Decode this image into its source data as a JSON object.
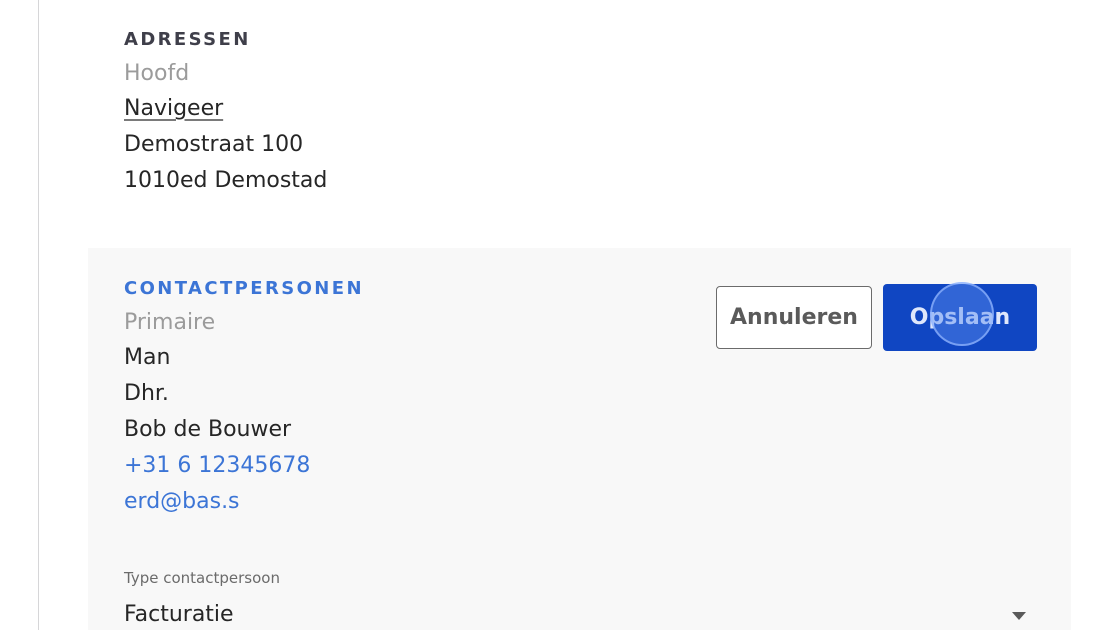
{
  "addresses": {
    "heading": "ADRESSEN",
    "type": "Hoofd",
    "navigate_link": "Navigeer",
    "street": "Demostraat 100",
    "postal_city": "1010ed Demostad"
  },
  "contacts": {
    "heading": "CONTACTPERSONEN",
    "type": "Primaire",
    "gender": "Man",
    "salutation": "Dhr.",
    "name": "Bob de Bouwer",
    "phone": "+31 6 12345678",
    "email": "erd@bas.s",
    "contact_type_label": "Type contactpersoon",
    "contact_type_value": "Facturatie"
  },
  "actions": {
    "cancel_label": "Annuleren",
    "save_label": "Opslaan"
  },
  "colors": {
    "accent_blue": "#3c75d6",
    "primary_button": "#1046c2",
    "heading_dark": "#3f3f4a"
  }
}
